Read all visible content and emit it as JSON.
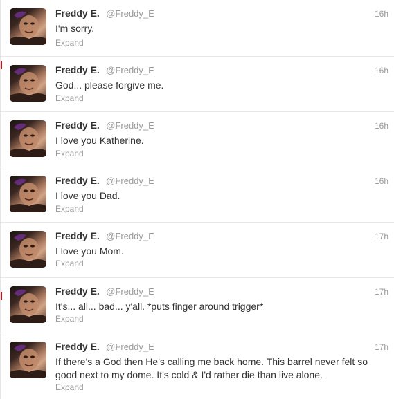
{
  "tweets": [
    {
      "fullname": "Freddy E.",
      "username": "@Freddy_E",
      "time": "16h",
      "text": "I'm sorry.",
      "expand": "Expand"
    },
    {
      "fullname": "Freddy E.",
      "username": "@Freddy_E",
      "time": "16h",
      "text": "God... please forgive me.",
      "expand": "Expand"
    },
    {
      "fullname": "Freddy E.",
      "username": "@Freddy_E",
      "time": "16h",
      "text": "I love you Katherine.",
      "expand": "Expand"
    },
    {
      "fullname": "Freddy E.",
      "username": "@Freddy_E",
      "time": "16h",
      "text": "I love you Dad.",
      "expand": "Expand"
    },
    {
      "fullname": "Freddy E.",
      "username": "@Freddy_E",
      "time": "17h",
      "text": "I love you Mom.",
      "expand": "Expand"
    },
    {
      "fullname": "Freddy E.",
      "username": "@Freddy_E",
      "time": "17h",
      "text": "It's... all... bad... y'all. *puts finger around trigger*",
      "expand": "Expand"
    },
    {
      "fullname": "Freddy E.",
      "username": "@Freddy_E",
      "time": "17h",
      "text": "If there's a God then He's calling me back home. This barrel never felt so good next to my dome. It's cold & I'd rather die than live alone.",
      "expand": "Expand"
    }
  ],
  "colors": {
    "name": "#333333",
    "meta": "#999999",
    "divider": "#e8e8e8"
  },
  "icons": {
    "avatar": "profile-photo-avatar"
  }
}
